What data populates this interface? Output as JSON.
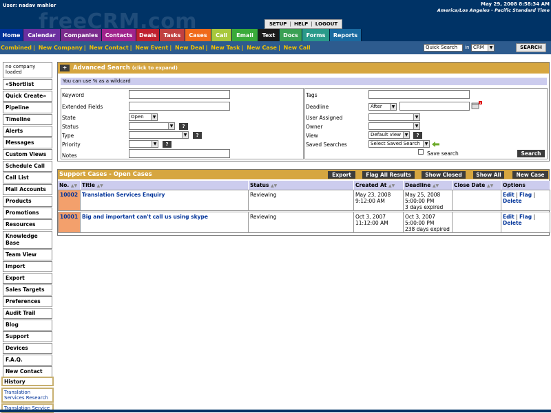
{
  "header": {
    "user": "User: nadav mahler",
    "logo": "freeCRM.com",
    "datetime": "May 29, 2008 8:58:34 AM",
    "timezone": "America/Los Angeles - Pacific Standard Time",
    "util_links": [
      "SETUP",
      "HELP",
      "LOGOUT"
    ]
  },
  "tabs": [
    {
      "label": "Home",
      "color": "#003399"
    },
    {
      "label": "Calendar",
      "color": "#6b2fa0"
    },
    {
      "label": "Companies",
      "color": "#7a2b8c"
    },
    {
      "label": "Contacts",
      "color": "#a0238c"
    },
    {
      "label": "Deals",
      "color": "#c0202f"
    },
    {
      "label": "Tasks",
      "color": "#c04040"
    },
    {
      "label": "Cases",
      "color": "#f06a1a"
    },
    {
      "label": "Call",
      "color": "#a8c83c"
    },
    {
      "label": "Email",
      "color": "#3aaa3a"
    },
    {
      "label": "Text",
      "color": "#1a1a1a"
    },
    {
      "label": "Docs",
      "color": "#3aa054"
    },
    {
      "label": "Forms",
      "color": "#2a9a8a"
    },
    {
      "label": "Reports",
      "color": "#1a6aa0"
    }
  ],
  "subnav": [
    "Combined",
    "New Company",
    "New Contact",
    "New Event",
    "New Deal",
    "New Task",
    "New Case",
    "New Call"
  ],
  "quick_search": {
    "placeholder": "Quick Search",
    "in_label": "in",
    "scope": "CRM",
    "button": "SEARCH"
  },
  "sidebar": {
    "no_company": "no company loaded",
    "items": [
      "«Shortlist",
      "Quick Create»",
      "Pipeline",
      "Timeline",
      "Alerts",
      "Messages",
      "Custom Views",
      "Schedule Call",
      "Call List",
      "Mail Accounts",
      "Products",
      "Promotions",
      "Resources",
      "Knowledge Base",
      "Team View",
      "Import",
      "Export",
      "Sales Targets",
      "Preferences",
      "Audit Trail",
      "Blog",
      "Support",
      "Devices",
      "F.A.Q.",
      "New Contact"
    ],
    "history_title": "History",
    "history": [
      "Translation Services Research",
      "Translation Service"
    ]
  },
  "advanced_search": {
    "title": "Advanced Search",
    "title_hint": "(click to expand)",
    "wildcard_note": "You can use % as a wildcard",
    "left_labels": [
      "Keyword",
      "Extended Fields",
      "State",
      "Status",
      "Type",
      "Priority",
      "Notes"
    ],
    "state_value": "Open",
    "right_labels": [
      "Tags",
      "Deadline",
      "User Assigned",
      "Owner",
      "View",
      "Saved Searches"
    ],
    "deadline_mode": "After",
    "view_value": "Default view",
    "saved_search_value": "Select Saved Search",
    "save_search_label": "Save search",
    "search_button": "Search"
  },
  "cases": {
    "title": "Support Cases - Open Cases",
    "buttons": [
      "Export",
      "Flag All Results",
      "Show Closed",
      "Show All",
      "New Case"
    ],
    "columns": [
      "No.",
      "Title",
      "Status",
      "Created At",
      "Deadline",
      "Close Date",
      "Options"
    ],
    "rows": [
      {
        "no": "10002",
        "title": "Translation Services Enquiry",
        "status": "Reviewing",
        "created_date": "May 23, 2008",
        "created_time": "9:12:00 AM",
        "deadline_date": "May 25, 2008",
        "deadline_time": "5:00:00 PM",
        "deadline_note": "3 days expired",
        "close": "",
        "opt_edit": "Edit",
        "opt_flag": "Flag",
        "opt_delete": "Delete"
      },
      {
        "no": "10001",
        "title": "Big and important can't call us using skype",
        "status": "Reviewing",
        "created_date": "Oct 3, 2007",
        "created_time": "11:12:00 AM",
        "deadline_date": "Oct 3, 2007",
        "deadline_time": "5:00:00 PM",
        "deadline_note": "238 days expired",
        "close": "",
        "opt_edit": "Edit",
        "opt_flag": "Flag",
        "opt_delete": "Delete"
      }
    ]
  }
}
